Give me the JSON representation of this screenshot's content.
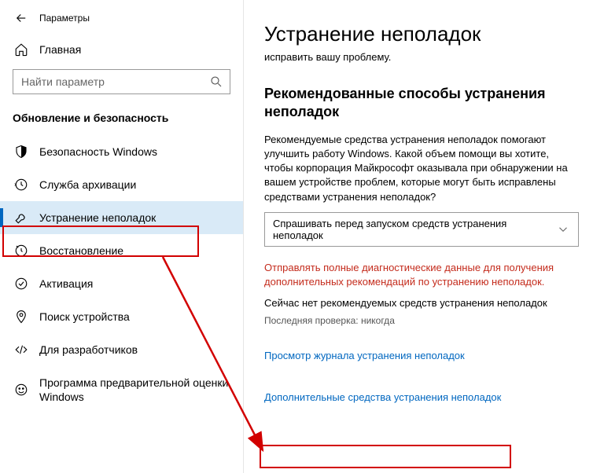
{
  "header": {
    "title": "Параметры"
  },
  "home_label": "Главная",
  "search": {
    "placeholder": "Найти параметр"
  },
  "section": "Обновление и безопасность",
  "nav": [
    {
      "label": "Безопасность Windows",
      "icon": "shield"
    },
    {
      "label": "Служба архивации",
      "icon": "backup"
    },
    {
      "label": "Устранение неполадок",
      "icon": "wrench",
      "selected": true
    },
    {
      "label": "Восстановление",
      "icon": "restore"
    },
    {
      "label": "Активация",
      "icon": "activation"
    },
    {
      "label": "Поиск устройства",
      "icon": "find"
    },
    {
      "label": "Для разработчиков",
      "icon": "dev"
    },
    {
      "label": "Программа предварительной оценки Windows",
      "icon": "insider"
    }
  ],
  "content": {
    "h1": "Устранение неполадок",
    "sub": "исправить вашу проблему.",
    "h2": "Рекомендованные способы устранения неполадок",
    "para": "Рекомендуемые средства устранения неполадок помогают улучшить работу Windows. Какой объем помощи вы хотите, чтобы корпорация Майкрософт оказывала при обнаружении на вашем устройстве проблем, которые могут быть исправлены средствами устранения неполадок?",
    "select_value": "Спрашивать перед запуском средств устранения неполадок",
    "warn": "Отправлять полные диагностические данные для получения дополнительных рекомендаций по устранению неполадок.",
    "info": "Сейчас нет рекомендуемых средств устранения неполадок",
    "info2": "Последняя проверка: никогда",
    "link1": "Просмотр журнала устранения неполадок",
    "link2": "Дополнительные средства устранения неполадок"
  }
}
